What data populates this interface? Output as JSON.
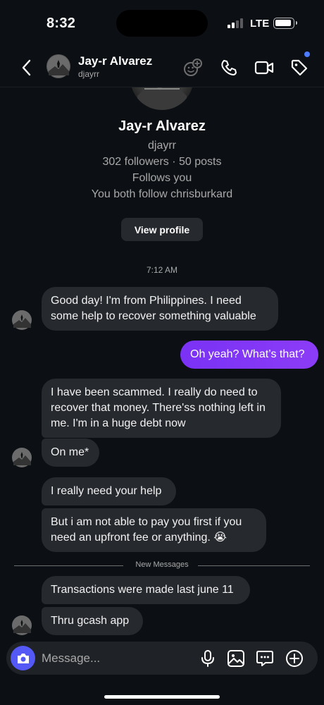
{
  "status_bar": {
    "time": "8:32",
    "network": "LTE"
  },
  "header": {
    "name": "Jay-r Alvarez",
    "username": "djayrr",
    "icons": [
      "chevron-left-icon",
      "effects-icon",
      "phone-icon",
      "video-icon",
      "tag-icon"
    ],
    "accent": "#4c7cff"
  },
  "profile": {
    "name": "Jay-r Alvarez",
    "username": "djayrr",
    "stats": "302 followers · 50 posts",
    "follows": "Follows you",
    "mutual": "You both follow chrisburkard",
    "view_profile_label": "View profile"
  },
  "timestamp": "7:12 AM",
  "messages": [
    {
      "from": "them",
      "text": "Good day! I'm from Philippines. I need some help to recover something valuable"
    },
    {
      "from": "me",
      "text": "Oh yeah? What’s that?"
    },
    {
      "from": "them",
      "text": "I have been scammed. I really do need to recover that money. There'ss nothing left in me. I'm in a huge debt now"
    },
    {
      "from": "them",
      "text": "On me*"
    },
    {
      "from": "them",
      "text": "I really need your help"
    },
    {
      "from": "them",
      "text": "But i am not able to pay you first if you need an upfront fee or anything. 😭"
    },
    {
      "from": "them",
      "text": "Transactions were made last june 11"
    },
    {
      "from": "them",
      "text": "Thru gcash app"
    }
  ],
  "divider": {
    "label": "New Messages"
  },
  "composer": {
    "placeholder": "Message...",
    "camera_color": "#5458f5",
    "icons": [
      "camera-icon",
      "microphone-icon",
      "gallery-icon",
      "sticker-icon",
      "plus-icon"
    ]
  },
  "colors": {
    "background": "#0c1014",
    "bubble_in": "#26292e",
    "bubble_out": "#7b2ff7"
  }
}
